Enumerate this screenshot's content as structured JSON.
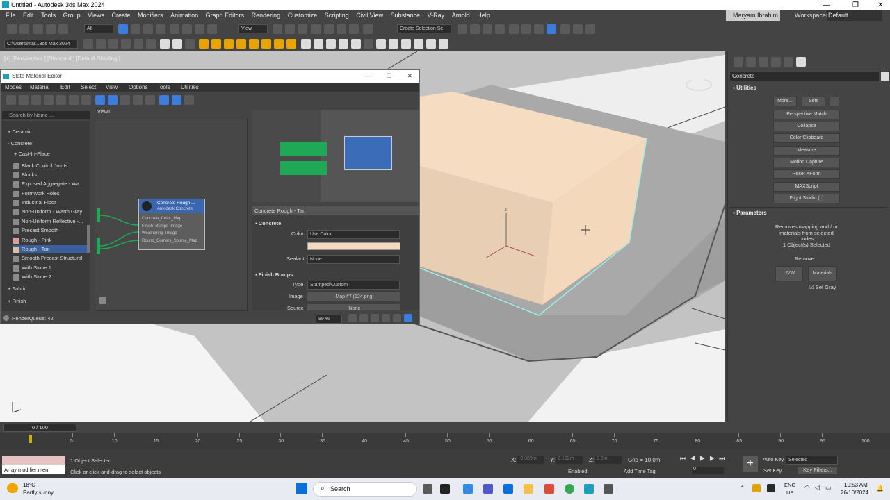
{
  "window": {
    "title": "Untitled - Autodesk 3ds Max 2024",
    "minimize": "—",
    "maximize": "❐",
    "close": "✕"
  },
  "menubar": {
    "items": [
      "File",
      "Edit",
      "Tools",
      "Group",
      "Views",
      "Create",
      "Modifiers",
      "Animation",
      "Graph Editors",
      "Rendering",
      "Customize",
      "Scripting",
      "Civil View",
      "Substance",
      "V-Ray",
      "Arnold",
      "Help"
    ],
    "user": "Maryam Ibrahim",
    "workspaces_label": "Workspaces:",
    "workspace_value": "Default"
  },
  "toolbar": {
    "filter_value": "All",
    "view_value": "View",
    "selection_set": "Create Selection Se",
    "path": "C:\\Users\\mar...3ds Max 2024"
  },
  "viewport": {
    "label": "[+] [Perspective ] [Standard ] [Default Shading ]"
  },
  "slate": {
    "title": "Slate Material Editor",
    "menu": [
      "Modes",
      "Material",
      "Edit",
      "Select",
      "View",
      "Options",
      "Tools",
      "Utilities"
    ],
    "search_placeholder": "Search by Name ...",
    "browser": {
      "cat_ceramic": "+ Ceramic",
      "cat_concrete": "- Concrete",
      "sub_cast": "+ Cast-In-Place",
      "items": [
        "Black Control Joints",
        "Blocks",
        "Exposed Aggregate - Wa...",
        "Formwork Holes",
        "Industrial Floor",
        "Non-Uniform - Warm Gray",
        "Non-Uniform Reflective -...",
        "Precast Smooth",
        "Rough - Pink",
        "Rough - Tan",
        "Smooth Precast Structural",
        "With Stone 1",
        "With Stone 2"
      ],
      "cat_fabric": "+ Fabric",
      "cat_finish": "+ Finish"
    },
    "view_tab": "View1",
    "node": {
      "title": "Concrete Rough ...",
      "subtitle": "Autodesk Concrete",
      "slots": [
        "Concrete_Color_Map",
        "Finish_Bumps_Image",
        "Weathering_Image",
        "Round_Corners_Source_Map"
      ]
    },
    "params": {
      "header": "Concrete Rough - Tan",
      "section_concrete": "Concrete",
      "color_label": "Color",
      "color_value": "Use Color",
      "swatch_color": "#f5d9bd",
      "sealant_label": "Sealant",
      "sealant_value": "None",
      "section_bumps": "Finish Bumps",
      "type_label": "Type",
      "type_value": "Stamped/Custom",
      "image_label": "Image",
      "image_value": "Map #7 (124.png)",
      "source_label": "Source",
      "source_value": "None"
    },
    "status": "RenderQueue: 42",
    "zoom": "89 %"
  },
  "cmdpanel": {
    "object_name": "Concrete",
    "utilities_header": "Utilities",
    "more_button": "More...",
    "sets_button": "Sets",
    "buttons": [
      "Perspective Match",
      "Collapse",
      "Color Clipboard",
      "Measure",
      "Motion Capture",
      "Reset XForm",
      "MAXScript",
      "Flight Studio (c)"
    ],
    "parameters_header": "Parameters",
    "desc": [
      "Removes mapping and / or",
      "materials from selected",
      "nodes"
    ],
    "selected": "1 Object(s) Selected",
    "remove_label": "Remove :",
    "uvw_button": "UVW",
    "materials_button": "Materials",
    "set_gray": "Set Gray"
  },
  "timeline": {
    "frame": "0 / 100",
    "ticks": [
      "0",
      "5",
      "10",
      "15",
      "20",
      "25",
      "30",
      "35",
      "40",
      "45",
      "50",
      "55",
      "60",
      "65",
      "70",
      "75",
      "80",
      "85",
      "90",
      "95",
      "100"
    ]
  },
  "bottom": {
    "maxscript": "Array modifier men",
    "status1": "1 Object Selected",
    "status2": "Click or click-and-drag to select objects",
    "x_label": "X:",
    "x_value": "-3.369m",
    "y_label": "Y:",
    "y_value": "2.132m",
    "z_label": "Z:",
    "z_value": "0.0m",
    "grid": "Grid = 10.0m",
    "enabled": "Enabled:",
    "add_time_tag": "Add Time Tag",
    "auto_key": "Auto Key",
    "selected": "Selected",
    "set_key": "Set Key",
    "key_filters": "Key Filters...",
    "frame_value": "0"
  },
  "taskbar": {
    "weather_temp": "18°C",
    "weather_desc": "Partly sunny",
    "search": "Search",
    "lang1": "ENG",
    "lang2": "US",
    "time": "10:53 AM",
    "date": "26/10/2024"
  }
}
